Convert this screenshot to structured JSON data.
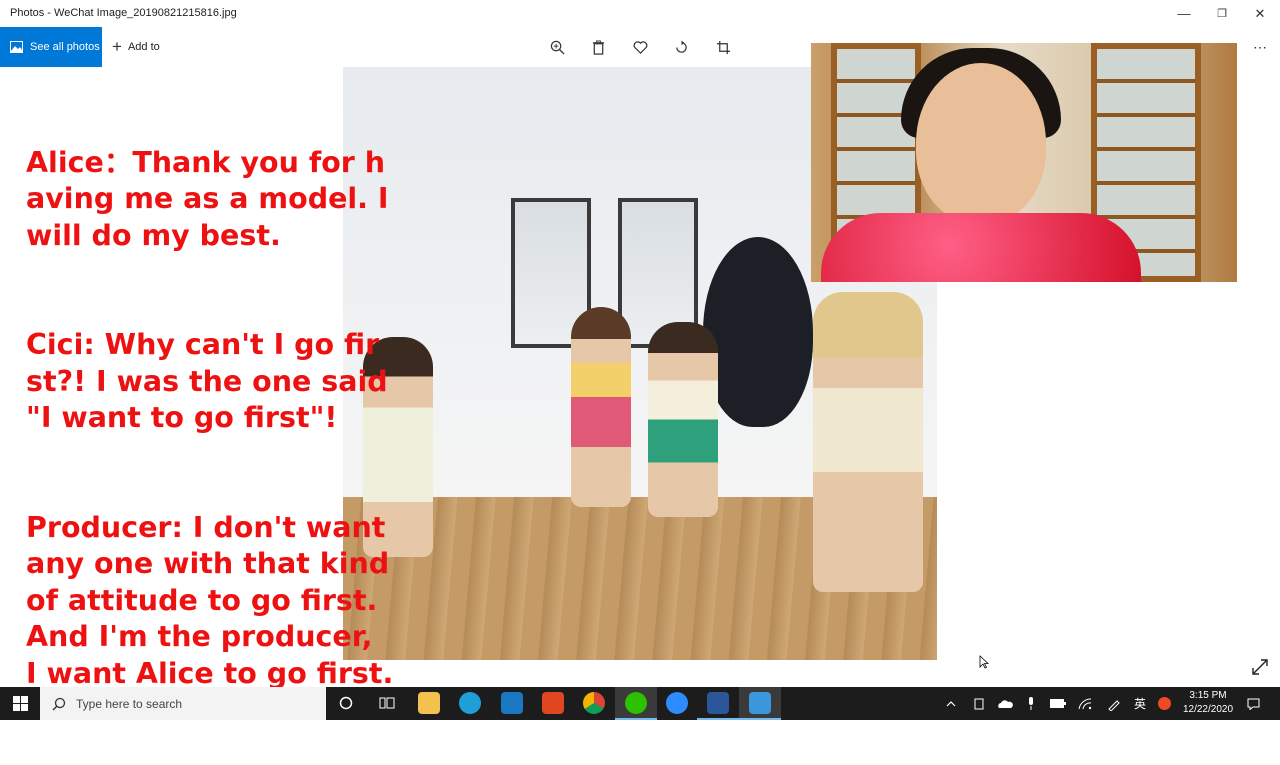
{
  "window": {
    "title": "Photos - WeChat Image_20190821215816.jpg",
    "minimize_glyph": "—",
    "maximize_glyph": "❐",
    "close_glyph": "✕"
  },
  "toolbar": {
    "see_all_label": "See all photos",
    "add_to_label": "Add to",
    "tools": [
      "zoom-icon",
      "delete-icon",
      "favorite-icon",
      "rotate-icon",
      "crop-icon"
    ],
    "more_glyph": "⋯"
  },
  "caption": {
    "paragraphs": [
      "Alice：Thank you for h\naving me as a model. I\nwill do my best.",
      "Cici: Why can't I go fir\nst?! I was the one said\n\"I want to go first\"!",
      "Producer: I don't want\nany one with that kind\nof attitude to go first.\nAnd I'm the producer,\nI want Alice to go first."
    ],
    "color": "#ee1111"
  },
  "taskbar": {
    "search_placeholder": "Type here to search",
    "apps": [
      "cortana-icon",
      "task-view-icon",
      "file-explorer-icon",
      "edge-icon",
      "mail-icon",
      "office-icon",
      "chrome-icon",
      "wechat-icon",
      "zoom-app-icon",
      "word-icon",
      "photos-icon"
    ],
    "tray": {
      "ime": "英",
      "time": "3:15 PM",
      "date": "12/22/2020"
    }
  },
  "colors": {
    "accent": "#0078d7",
    "taskbar": "#1c1c1c"
  }
}
